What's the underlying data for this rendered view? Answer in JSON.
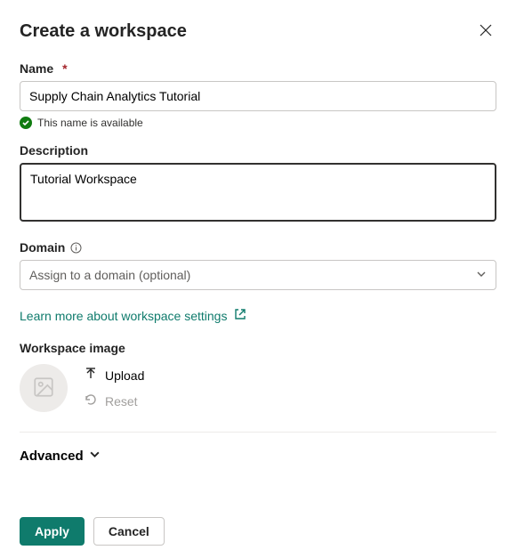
{
  "header": {
    "title": "Create a workspace"
  },
  "name_field": {
    "label": "Name",
    "value": "Supply Chain Analytics Tutorial",
    "availability_msg": "This name is available"
  },
  "description_field": {
    "label": "Description",
    "value": "Tutorial Workspace"
  },
  "domain_field": {
    "label": "Domain",
    "placeholder": "Assign to a domain (optional)"
  },
  "learn_more_link": "Learn more about workspace settings",
  "workspace_image": {
    "label": "Workspace image",
    "upload_label": "Upload",
    "reset_label": "Reset"
  },
  "advanced_label": "Advanced",
  "footer": {
    "apply_label": "Apply",
    "cancel_label": "Cancel"
  }
}
